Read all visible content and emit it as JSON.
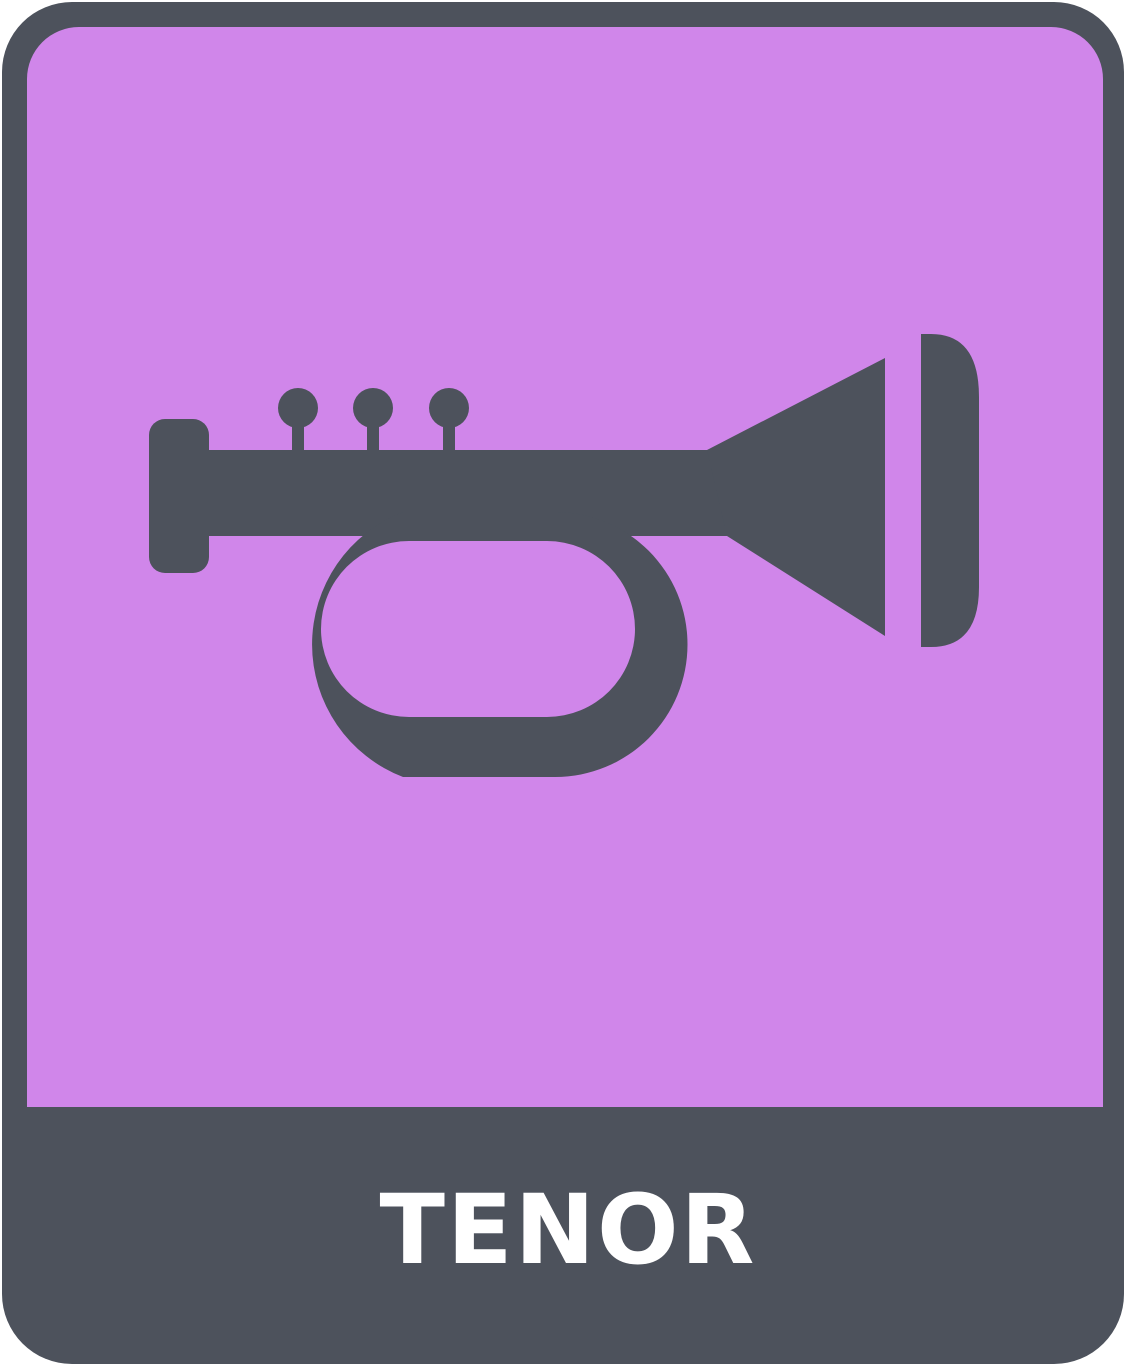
{
  "card": {
    "label": "TENOR",
    "icon": "trumpet-icon",
    "colors": {
      "frame": "#4d525c",
      "panel": "#d086ea",
      "label": "#ffffff"
    }
  }
}
